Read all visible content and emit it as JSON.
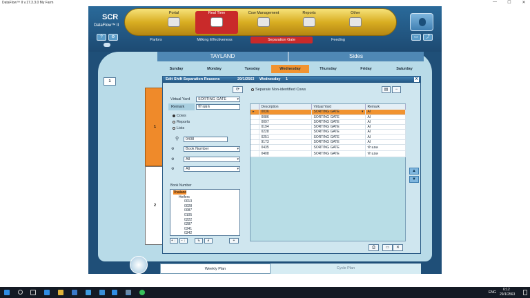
{
  "window": {
    "title": "DataFlow™ II v.17.3.3.0 My Farm",
    "minimize": "—",
    "maximize": "☐",
    "close": "✕"
  },
  "brand": {
    "logo": "SCR",
    "product": "DataFlow™ II"
  },
  "nav": {
    "tabs": [
      {
        "label": "Portal",
        "icon": "portal-icon"
      },
      {
        "label": "Real Time",
        "icon": "milk-tank-icon"
      },
      {
        "label": "Cow Management",
        "icon": "cow-icon"
      },
      {
        "label": "Reports",
        "icon": "report-icon"
      },
      {
        "label": "Other",
        "icon": "tools-icon"
      }
    ],
    "active_tab": "Real Time",
    "subtabs": [
      "Parlors",
      "Milking Effectiveness",
      "Separation Gate",
      "Feeding"
    ],
    "active_subtab": "Separation Gate"
  },
  "yard_bar": {
    "left": "TAYLAND",
    "right": "Sides"
  },
  "days": [
    "Sunday",
    "Monday",
    "Tuesday",
    "Wednesday",
    "Thursday",
    "Friday",
    "Saturday"
  ],
  "active_day": "Wednesday",
  "page_chip": "1",
  "shifts": [
    "1",
    "2"
  ],
  "dialog": {
    "title": "Edit Shift Separation Reasons",
    "date": "29/1/2563",
    "day": "Wednesday",
    "shift": "1",
    "close": "X",
    "separate_checkbox": "Separate Non-identified Cows",
    "virtual_yard_label": "Virtual Yard",
    "virtual_yard_value": "SORTING GATE",
    "remark_label": "Remark",
    "remark_value": "ทำแผล",
    "radios": [
      {
        "label": "Cows",
        "checked": true
      },
      {
        "label": "Reports",
        "checked": false
      },
      {
        "label": "Lists",
        "checked": false
      }
    ],
    "search_value": "0408",
    "field_select": "Book Number",
    "filter1": "All",
    "filter2": "All",
    "tree_header": "Book Number",
    "tree": [
      {
        "label": "Thailand",
        "level": 0,
        "highlight": true
      },
      {
        "label": "Heifers",
        "level": 1,
        "highlight": false
      },
      {
        "label": "0013",
        "level": 2,
        "highlight": false
      },
      {
        "label": "0028",
        "level": 2,
        "highlight": false
      },
      {
        "label": "0087",
        "level": 2,
        "highlight": false
      },
      {
        "label": "0105",
        "level": 2,
        "highlight": false
      },
      {
        "label": "0222",
        "level": 2,
        "highlight": false
      },
      {
        "label": "0287",
        "level": 2,
        "highlight": false
      },
      {
        "label": "0341",
        "level": 2,
        "highlight": false
      },
      {
        "label": "0342",
        "level": 2,
        "highlight": false
      }
    ],
    "table": {
      "headers": [
        "Description",
        "Virtual Yard",
        "Remark"
      ],
      "rows": [
        {
          "description": "0036",
          "yard": "SORTING GATE",
          "remark": "AI",
          "highlight": true
        },
        {
          "description": "0086",
          "yard": "SORTING GATE",
          "remark": "AI",
          "highlight": false
        },
        {
          "description": "0097",
          "yard": "SORTING GATE",
          "remark": "AI",
          "highlight": false
        },
        {
          "description": "0194",
          "yard": "SORTING GATE",
          "remark": "AI",
          "highlight": false
        },
        {
          "description": "0228",
          "yard": "SORTING GATE",
          "remark": "AI",
          "highlight": false
        },
        {
          "description": "0251",
          "yard": "SORTING GATE",
          "remark": "AI",
          "highlight": false
        },
        {
          "description": "9173",
          "yard": "SORTING GATE",
          "remark": "AI",
          "highlight": false
        },
        {
          "description": "0435",
          "yard": "SORTING GATE",
          "remark": "ทำแผล",
          "highlight": false
        },
        {
          "description": "0408",
          "yard": "SORTING GATE",
          "remark": "ทำแผล",
          "highlight": false
        }
      ]
    }
  },
  "bottom_tabs": [
    "Weekly Plan",
    "Cycle Plan"
  ],
  "active_bottom_tab": "Weekly Plan",
  "taskbar": {
    "time": "6:12",
    "date": "29/1/2563",
    "lang": "ENG",
    "colors": {
      "bar": "#141a24",
      "accent": "#2f8de4"
    }
  },
  "colors": {
    "accent": "#f19330",
    "header": "#1f4f78",
    "active_nav": "#c92a2a",
    "panel": "#b8dbe8"
  }
}
